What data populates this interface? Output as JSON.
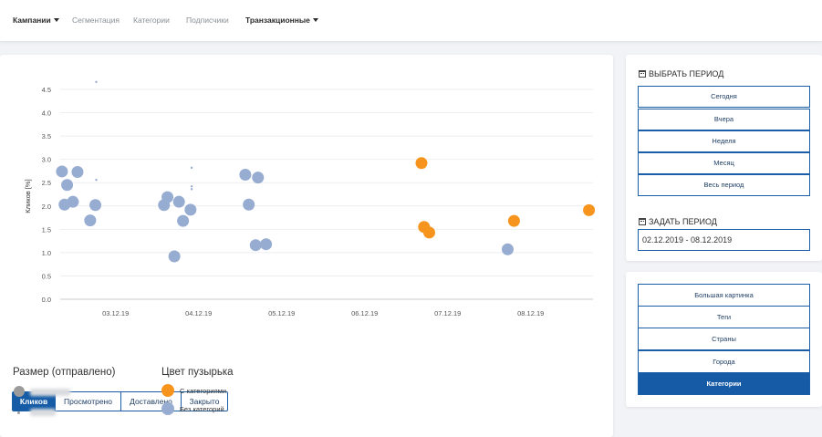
{
  "nav": {
    "items": [
      {
        "label": "Кампании",
        "bold": true,
        "caret": true
      },
      {
        "label": "Сегментация"
      },
      {
        "label": "Категории"
      },
      {
        "label": "Подписчики"
      },
      {
        "label": "Транзакционные",
        "bold": true,
        "caret": true
      }
    ]
  },
  "chart_data": {
    "type": "scatter",
    "ylabel": "Кликов [%]",
    "xlabel": "",
    "ylim": [
      0,
      4.5
    ],
    "yticks": [
      "0.0",
      "0.5",
      "1.0",
      "1.5",
      "2.0",
      "2.5",
      "3.0",
      "3.5",
      "4.0",
      "4.5"
    ],
    "xlim": [
      "2019-12-02 08:00",
      "2019-12-08 18:00"
    ],
    "xticks": [
      {
        "label": "03.12.19",
        "date": "2019-12-03 00:00"
      },
      {
        "label": "04.12.19",
        "date": "2019-12-04 00:00"
      },
      {
        "label": "05.12.19",
        "date": "2019-12-05 00:00"
      },
      {
        "label": "06.12.19",
        "date": "2019-12-06 00:00"
      },
      {
        "label": "07.12.19",
        "date": "2019-12-07 00:00"
      },
      {
        "label": "08.12.19",
        "date": "2019-12-08 00:00"
      }
    ],
    "grid": true,
    "series": [
      {
        "name": "С категориями",
        "color": "#f7941d",
        "points": [
          {
            "x": "2019-12-06 16:25",
            "y": 2.92,
            "size": "large"
          },
          {
            "x": "2019-12-06 17:10",
            "y": 1.55,
            "size": "large"
          },
          {
            "x": "2019-12-06 18:40",
            "y": 1.43,
            "size": "large"
          },
          {
            "x": "2019-12-07 19:10",
            "y": 1.68,
            "size": "large"
          },
          {
            "x": "2019-12-08 16:50",
            "y": 1.91,
            "size": "large"
          }
        ]
      },
      {
        "name": "Без категорий",
        "color": "#97acd1",
        "points": [
          {
            "x": "2019-12-02 08:30",
            "y": 2.74,
            "size": "large"
          },
          {
            "x": "2019-12-02 09:15",
            "y": 2.03,
            "size": "large"
          },
          {
            "x": "2019-12-02 10:00",
            "y": 2.45,
            "size": "large"
          },
          {
            "x": "2019-12-02 11:40",
            "y": 2.09,
            "size": "large"
          },
          {
            "x": "2019-12-02 13:00",
            "y": 2.73,
            "size": "large"
          },
          {
            "x": "2019-12-02 16:40",
            "y": 1.69,
            "size": "large"
          },
          {
            "x": "2019-12-02 18:10",
            "y": 2.02,
            "size": "large"
          },
          {
            "x": "2019-12-02 18:25",
            "y": 4.66,
            "size": "small"
          },
          {
            "x": "2019-12-02 18:25",
            "y": 2.56,
            "size": "small"
          },
          {
            "x": "2019-12-03 14:00",
            "y": 2.02,
            "size": "large"
          },
          {
            "x": "2019-12-03 15:00",
            "y": 2.19,
            "size": "large"
          },
          {
            "x": "2019-12-03 17:00",
            "y": 0.92,
            "size": "large"
          },
          {
            "x": "2019-12-03 18:20",
            "y": 2.09,
            "size": "large"
          },
          {
            "x": "2019-12-03 19:30",
            "y": 1.68,
            "size": "large"
          },
          {
            "x": "2019-12-03 21:40",
            "y": 1.92,
            "size": "large"
          },
          {
            "x": "2019-12-03 22:00",
            "y": 2.82,
            "size": "small"
          },
          {
            "x": "2019-12-03 22:00",
            "y": 2.42,
            "size": "small"
          },
          {
            "x": "2019-12-03 22:00",
            "y": 2.36,
            "size": "small"
          },
          {
            "x": "2019-12-04 13:30",
            "y": 2.67,
            "size": "large"
          },
          {
            "x": "2019-12-04 14:30",
            "y": 2.03,
            "size": "large"
          },
          {
            "x": "2019-12-04 16:30",
            "y": 1.16,
            "size": "large"
          },
          {
            "x": "2019-12-04 17:10",
            "y": 2.61,
            "size": "large"
          },
          {
            "x": "2019-12-04 19:30",
            "y": 1.18,
            "size": "large"
          },
          {
            "x": "2019-12-07 17:20",
            "y": 1.07,
            "size": "large"
          }
        ]
      }
    ]
  },
  "metric_tabs": [
    {
      "label": "Кликов",
      "active": true
    },
    {
      "label": "Просмотрено"
    },
    {
      "label": "Доставлено"
    },
    {
      "label": "Закрыто"
    }
  ],
  "legend": {
    "size_title": "Размер (отправлено)",
    "color_title": "Цвет пузырька",
    "color_items": [
      {
        "label": "С категориями",
        "color": "#f7941d"
      },
      {
        "label": "Без категорий",
        "color": "#97acd1"
      }
    ]
  },
  "period": {
    "title": "ВЫБРАТЬ ПЕРИОД",
    "icon": "calendar-icon",
    "options": [
      "Сегодня",
      "Вчера",
      "Неделя",
      "Месяц",
      "Весь период"
    ]
  },
  "custom_period": {
    "title": "ЗАДАТЬ ПЕРИОД",
    "icon": "calendar-icon",
    "value": "02.12.2019 - 08.12.2019"
  },
  "views": [
    {
      "label": "Большая картинка"
    },
    {
      "label": "Теги"
    },
    {
      "label": "Страны"
    },
    {
      "label": "Города"
    },
    {
      "label": "Категории",
      "active": true
    }
  ],
  "colors": {
    "accent": "#155ba6",
    "orange": "#f7941d",
    "blue_gray": "#97acd1"
  }
}
